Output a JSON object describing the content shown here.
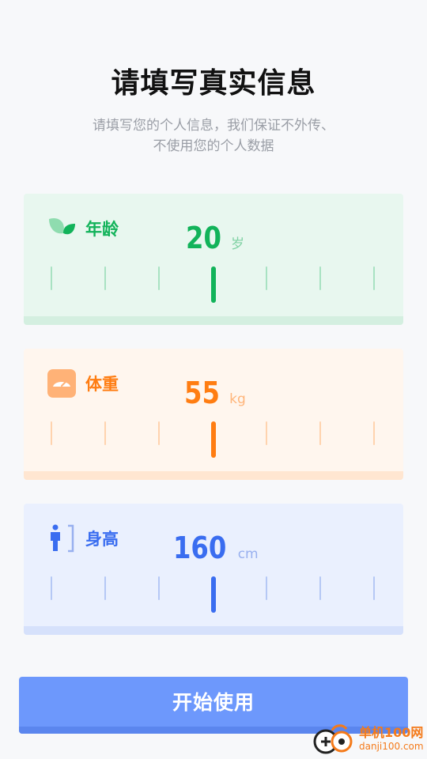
{
  "header": {
    "title": "请填写真实信息",
    "subtitle_line1": "请填写您的个人信息，我们保证不外传、",
    "subtitle_line2": "不使用您的个人数据"
  },
  "cards": {
    "age": {
      "label": "年龄",
      "value": "20",
      "unit": "岁",
      "icon": "leaf-icon",
      "color": "#12b35a"
    },
    "weight": {
      "label": "体重",
      "value": "55",
      "unit": "kg",
      "icon": "scale-icon",
      "color": "#ff7d12"
    },
    "height": {
      "label": "身高",
      "value": "160",
      "unit": "cm",
      "icon": "person-height-icon",
      "color": "#3a6df0"
    }
  },
  "button": {
    "start_label": "开始使用",
    "color": "#6d98fc"
  },
  "watermark": {
    "text1": "单机100网",
    "text2": "danji100.com"
  }
}
